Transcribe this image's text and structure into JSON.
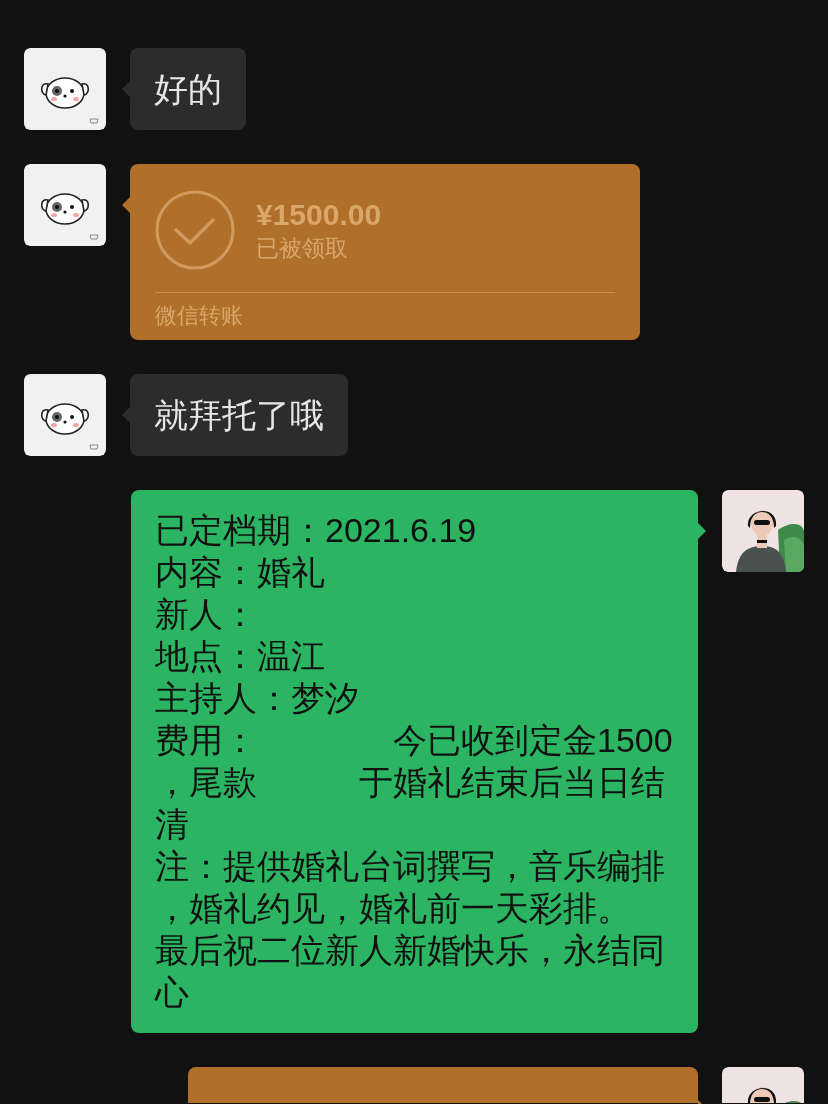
{
  "messages": [
    {
      "kind": "text",
      "outgoing": false,
      "lines": [
        "好的"
      ]
    },
    {
      "kind": "transfer",
      "outgoing": false,
      "amount": "¥1500.00",
      "status": "已被领取",
      "label": "微信转账"
    },
    {
      "kind": "text",
      "outgoing": false,
      "lines": [
        "就拜托了哦"
      ]
    },
    {
      "kind": "text",
      "outgoing": true,
      "lines": [
        "已定档期：2021.6.19",
        "内容：婚礼",
        "新人：",
        "地点：温江",
        "主持人：梦汐",
        "费用：　　　　今已收到定金1500，尾款　　　于婚礼结束后当日结清",
        "注：提供婚礼台词撰写，音乐编排，婚礼约见，婚礼前一天彩排。",
        "最后祝二位新人新婚快乐，永结同心"
      ]
    },
    {
      "kind": "transfer",
      "outgoing": true
    }
  ]
}
